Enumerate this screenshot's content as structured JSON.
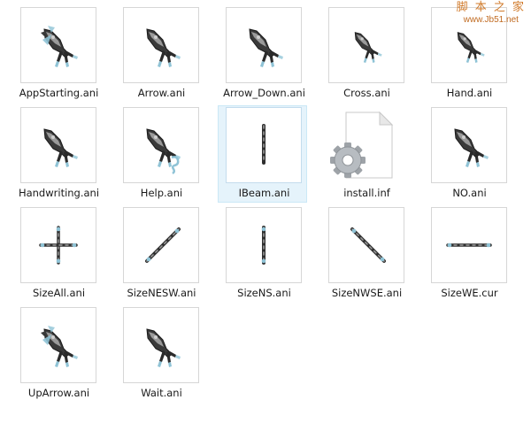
{
  "watermark": {
    "line1": "脚 本 之 家",
    "line2": "www.Jb51.net"
  },
  "files": [
    {
      "name": "AppStarting.ani",
      "icon": "app-starting-cursor-icon",
      "kind": "arrow-busy"
    },
    {
      "name": "Arrow.ani",
      "icon": "arrow-cursor-icon",
      "kind": "arrow"
    },
    {
      "name": "Arrow_Down.ani",
      "icon": "arrow-down-cursor-icon",
      "kind": "arrow"
    },
    {
      "name": "Cross.ani",
      "icon": "cross-cursor-icon",
      "kind": "arrow-small"
    },
    {
      "name": "Hand.ani",
      "icon": "hand-cursor-icon",
      "kind": "arrow-small"
    },
    {
      "name": "Handwriting.ani",
      "icon": "handwriting-cursor-icon",
      "kind": "arrow"
    },
    {
      "name": "Help.ani",
      "icon": "help-cursor-icon",
      "kind": "arrow-help"
    },
    {
      "name": "IBeam.ani",
      "icon": "ibeam-cursor-icon",
      "kind": "ibeam",
      "selected": true
    },
    {
      "name": "install.inf",
      "icon": "settings-file-icon",
      "kind": "file"
    },
    {
      "name": "NO.ani",
      "icon": "no-cursor-icon",
      "kind": "arrow"
    },
    {
      "name": "SizeAll.ani",
      "icon": "size-all-cursor-icon",
      "kind": "sizeall"
    },
    {
      "name": "SizeNESW.ani",
      "icon": "size-nesw-cursor-icon",
      "kind": "nesw"
    },
    {
      "name": "SizeNS.ani",
      "icon": "size-ns-cursor-icon",
      "kind": "ns"
    },
    {
      "name": "SizeNWSE.ani",
      "icon": "size-nwse-cursor-icon",
      "kind": "nwse"
    },
    {
      "name": "SizeWE.cur",
      "icon": "size-we-cursor-icon",
      "kind": "we"
    },
    {
      "name": "UpArrow.ani",
      "icon": "up-arrow-cursor-icon",
      "kind": "arrow-busy"
    },
    {
      "name": "Wait.ani",
      "icon": "wait-cursor-icon",
      "kind": "arrow"
    }
  ]
}
